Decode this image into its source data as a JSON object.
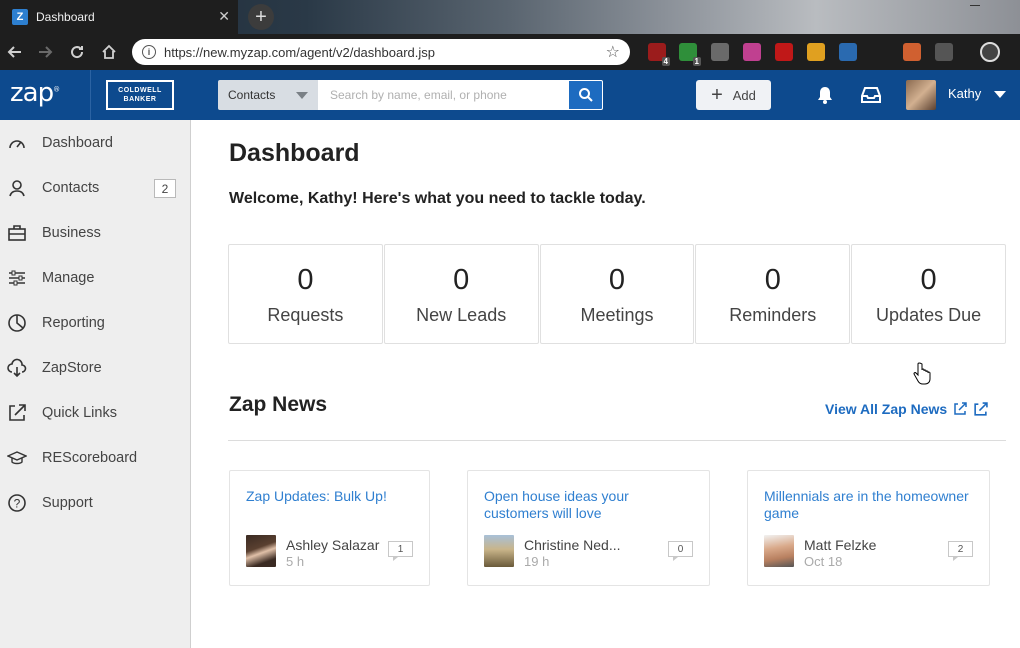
{
  "browser": {
    "tab_title": "Dashboard",
    "favicon_letter": "Z",
    "url": "https://new.myzap.com/agent/v2/dashboard.jsp",
    "extensions": [
      {
        "name": "ublock-icon",
        "color": "#9b1c1c",
        "badge": "4"
      },
      {
        "name": "extension-green-icon",
        "color": "#2f8f3a",
        "badge": "1"
      },
      {
        "name": "gear-ext-icon",
        "color": "#6a6a6a",
        "badge": ""
      },
      {
        "name": "pinwheel-icon",
        "color": "#c04090",
        "badge": ""
      },
      {
        "name": "pen-ext-icon",
        "color": "#c01818",
        "badge": ""
      },
      {
        "name": "compass-ext-icon",
        "color": "#e0a020",
        "badge": ""
      },
      {
        "name": "screen-ext-icon",
        "color": "#2a6ab0",
        "badge": ""
      },
      {
        "name": "fox-ext-icon",
        "color": "#d06030",
        "badge": ""
      },
      {
        "name": "w-ext-icon",
        "color": "#555555",
        "badge": ""
      }
    ]
  },
  "header": {
    "logo": "zap",
    "brand_line1": "COLDWELL",
    "brand_line2": "BANKER",
    "search_scope": "Contacts",
    "search_placeholder": "Search by name, email, or phone",
    "add_label": "Add",
    "user_name": "Kathy"
  },
  "sidebar": {
    "items": [
      {
        "label": "Dashboard",
        "icon": "gauge-icon"
      },
      {
        "label": "Contacts",
        "icon": "person-icon",
        "badge": "2"
      },
      {
        "label": "Business",
        "icon": "briefcase-icon"
      },
      {
        "label": "Manage",
        "icon": "sliders-icon"
      },
      {
        "label": "Reporting",
        "icon": "pie-chart-icon"
      },
      {
        "label": "ZapStore",
        "icon": "cloud-download-icon"
      },
      {
        "label": "Quick Links",
        "icon": "external-link-icon"
      },
      {
        "label": "REScoreboard",
        "icon": "graduation-cap-icon"
      },
      {
        "label": "Support",
        "icon": "question-icon"
      }
    ]
  },
  "main": {
    "title": "Dashboard",
    "welcome": "Welcome, Kathy! Here's what you need to tackle today.",
    "stats": [
      {
        "value": "0",
        "label": "Requests"
      },
      {
        "value": "0",
        "label": "New Leads"
      },
      {
        "value": "0",
        "label": "Meetings"
      },
      {
        "value": "0",
        "label": "Reminders"
      },
      {
        "value": "0",
        "label": "Updates Due"
      }
    ],
    "news": {
      "title": "Zap News",
      "view_all": "View All Zap News",
      "cards": [
        {
          "title": "Zap Updates: Bulk Up!",
          "author": "Ashley Salazar",
          "time": "5 h",
          "comments": "1"
        },
        {
          "title": "Open house ideas your customers will love",
          "author": "Christine Ned...",
          "time": "19 h",
          "comments": "0"
        },
        {
          "title": "Millennials are in the homeowner game",
          "author": "Matt Felzke",
          "time": "Oct 18",
          "comments": "2"
        }
      ]
    }
  }
}
